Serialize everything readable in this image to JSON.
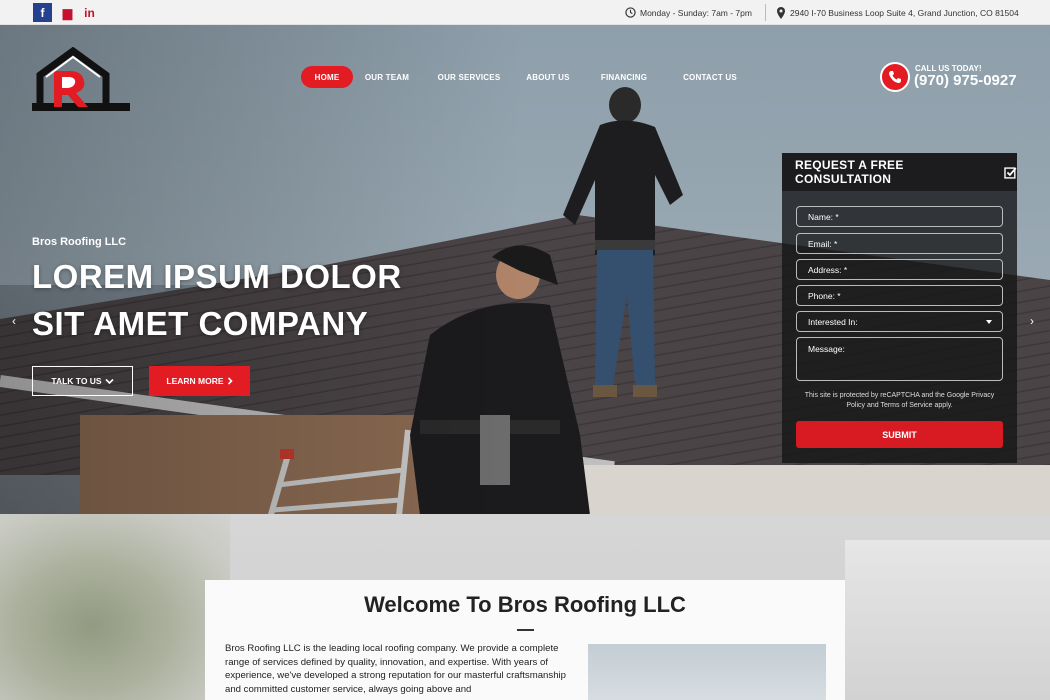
{
  "topbar": {
    "social": [
      {
        "name": "facebook",
        "glyph": "f"
      },
      {
        "name": "google-my-business",
        "glyph": "▆"
      },
      {
        "name": "linkedin",
        "glyph": "in"
      }
    ],
    "hours": "Monday - Sunday: 7am - 7pm",
    "address": "2940 I-70 Business Loop Suite 4, Grand Junction, CO 81504"
  },
  "header": {
    "nav": [
      "HOME",
      "OUR TEAM",
      "OUR SERVICES",
      "ABOUT US",
      "FINANCING",
      "CONTACT US"
    ],
    "active_nav": "HOME",
    "call_label": "CALL US TODAY!",
    "phone": "(970) 975-0927"
  },
  "hero": {
    "subtitle": "Bros Roofing LLC",
    "title_line1": "LOREM IPSUM DOLOR",
    "title_line2": "SIT AMET COMPANY",
    "btn_talk": "TALK TO US",
    "btn_learn": "LEARN MORE",
    "prev_arrow": "‹",
    "next_arrow": "›"
  },
  "form": {
    "title": "REQUEST A FREE CONSULTATION",
    "fields": {
      "name": "Name: *",
      "email": "Email: *",
      "address": "Address: *",
      "phone": "Phone: *",
      "interested": "Interested In:",
      "message": "Message:"
    },
    "recaptcha": "This site is protected by reCAPTCHA and the Google Privacy Policy and Terms of Service apply.",
    "submit": "SUBMIT"
  },
  "welcome": {
    "title": "Welcome To Bros Roofing LLC",
    "text": "Bros Roofing LLC is the leading local roofing company. We provide a complete range of services defined by quality, innovation, and expertise. With years of experience, we've developed a strong reputation for our masterful craftsmanship and committed customer service, always going above and"
  },
  "colors": {
    "accent": "#e31b23",
    "topbar_bg": "#f2f2f2",
    "form_bg": "#1c1c1e"
  }
}
